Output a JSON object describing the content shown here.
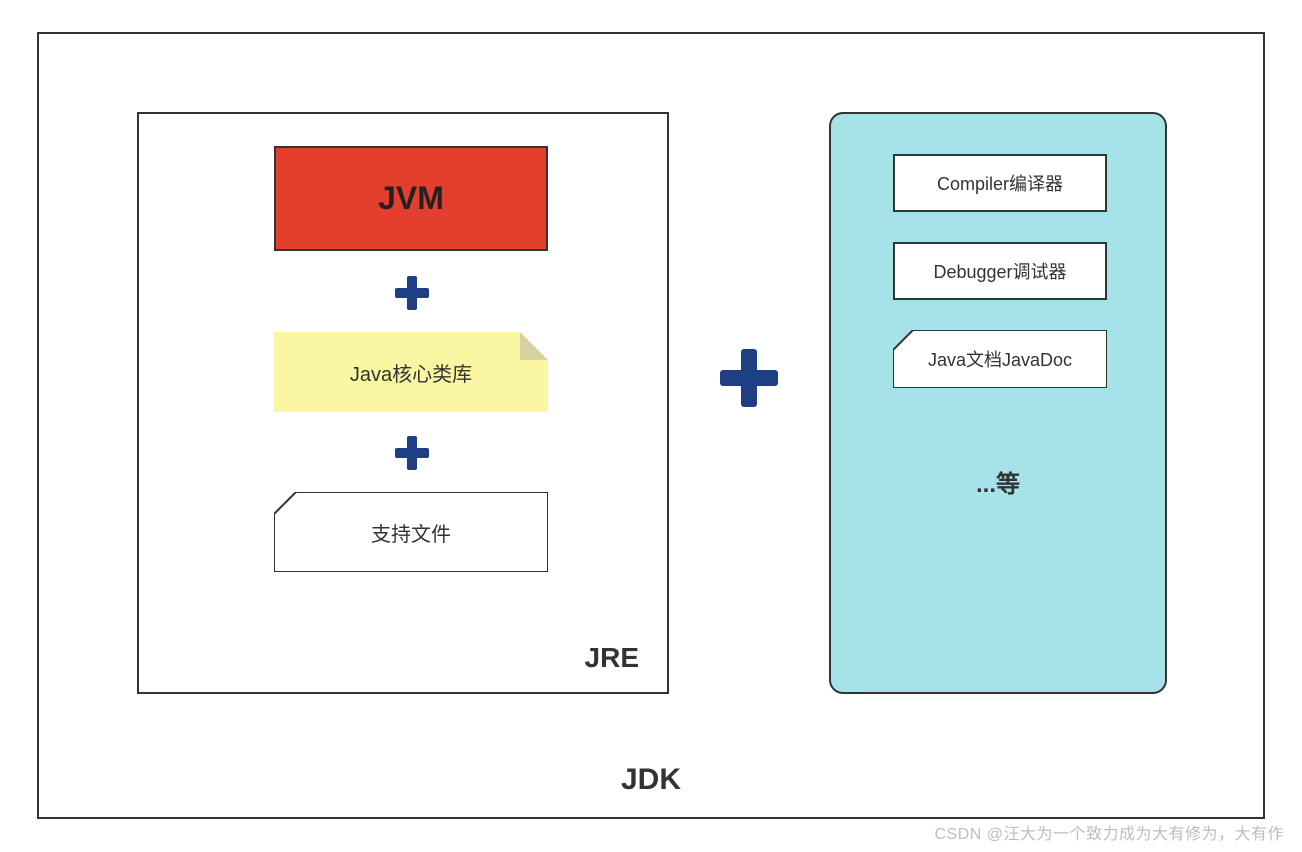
{
  "jdk": {
    "label": "JDK",
    "jre": {
      "label": "JRE",
      "jvm": "JVM",
      "corelib": "Java核心类库",
      "support": "支持文件"
    },
    "tools": {
      "compiler": "Compiler编译器",
      "debugger": "Debugger调试器",
      "javadoc": "Java文档JavaDoc",
      "etc": "...等"
    }
  },
  "watermark": "CSDN @汪大为一个致力成为大有修为，大有作",
  "colors": {
    "jvm_bg": "#e43f2c",
    "corelib_bg": "#fbf6a2",
    "tools_bg": "#a5e3e8",
    "plus": "#1f3f85",
    "border": "#333333"
  }
}
